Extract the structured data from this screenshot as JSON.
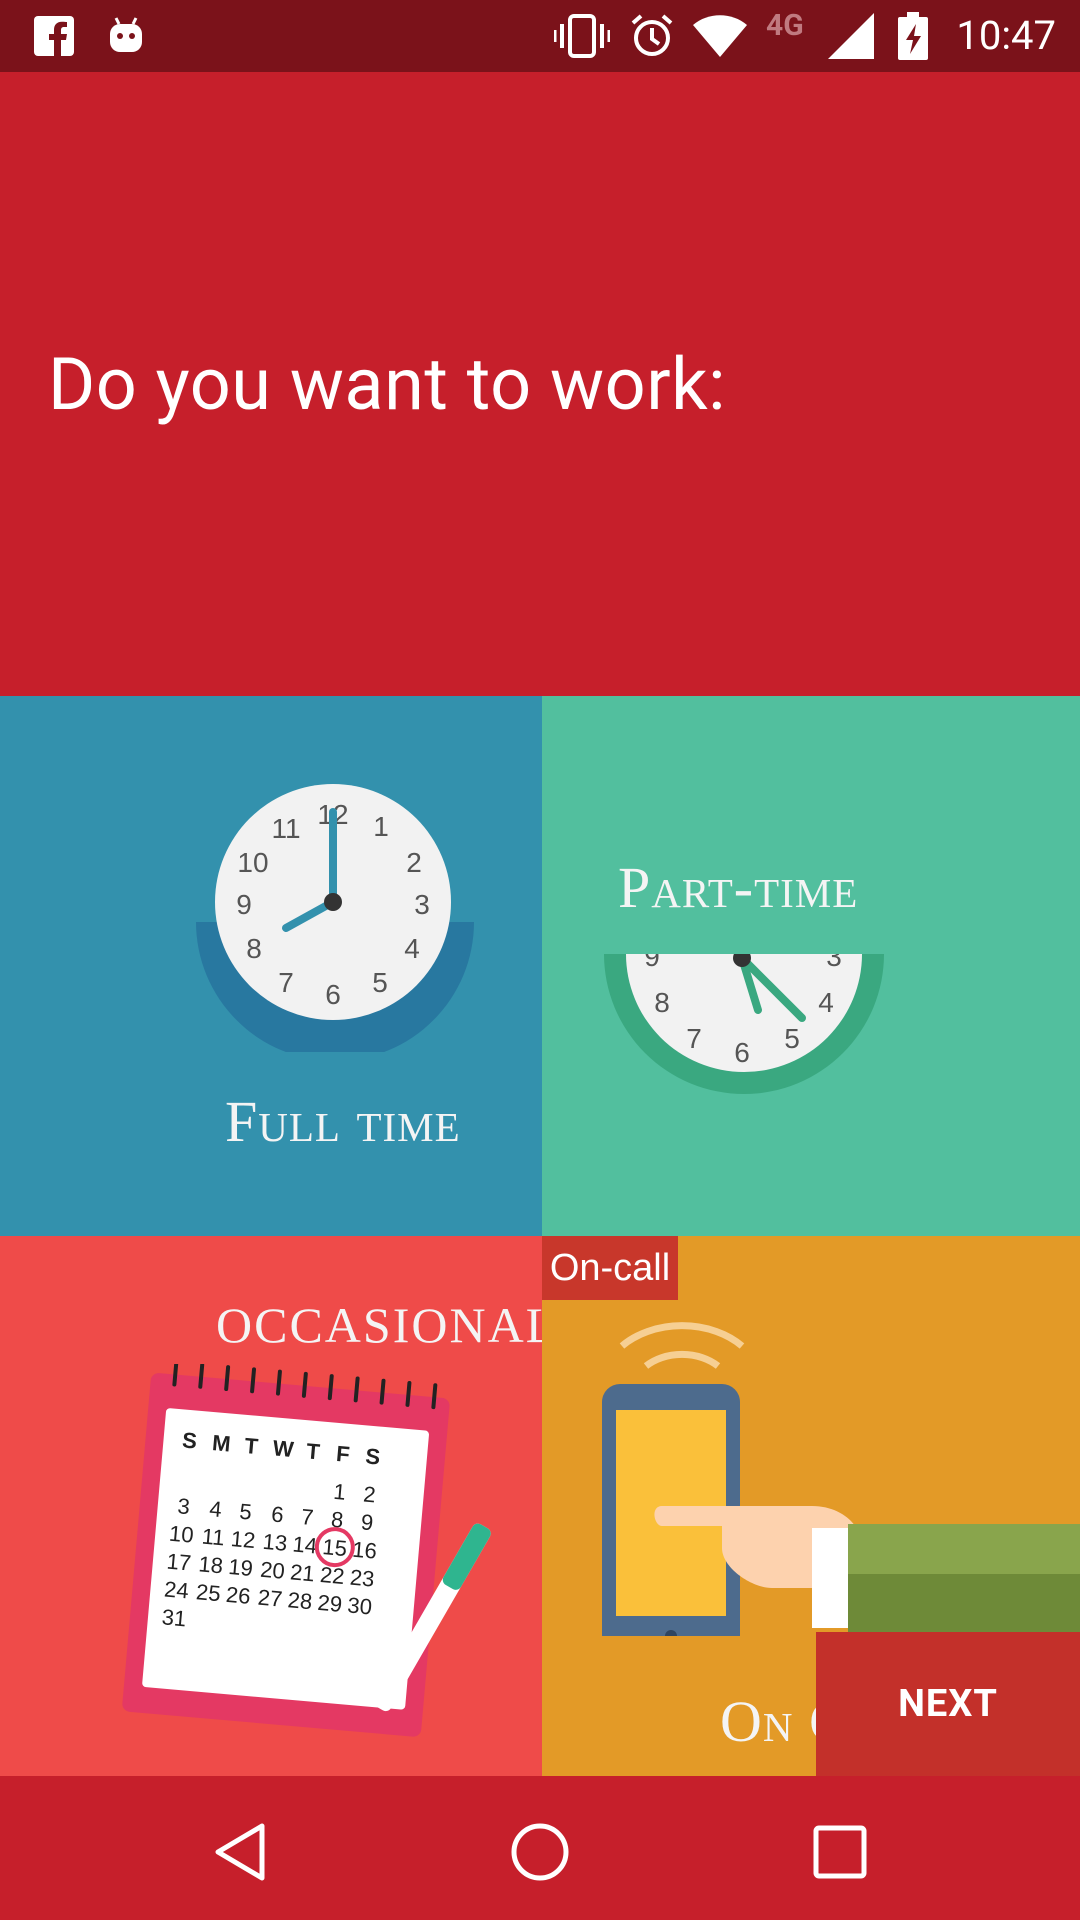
{
  "status_bar": {
    "time": "10:47",
    "network": "4G",
    "icons": [
      "facebook-icon",
      "android-icon",
      "vibrate-icon",
      "alarm-icon",
      "wifi-icon",
      "signal-icon",
      "battery-charging-icon"
    ]
  },
  "header": {
    "question": "Do you want to work:"
  },
  "options": {
    "full_time": "Full time",
    "part_time": "Part-time",
    "occasional": "OCCASIONAL",
    "on_call": "On Call",
    "on_call_badge": "On-call"
  },
  "calendar": {
    "weekdays": [
      "S",
      "M",
      "T",
      "W",
      "T",
      "F",
      "S"
    ],
    "highlighted_day": "15"
  },
  "actions": {
    "next_label": "NEXT"
  },
  "colors": {
    "status_bar": "#7b121a",
    "primary": "#c61f2b",
    "full_time": "#3391ad",
    "part_time": "#52bf9e",
    "occasional": "#ef4b49",
    "on_call": "#e39a27"
  }
}
